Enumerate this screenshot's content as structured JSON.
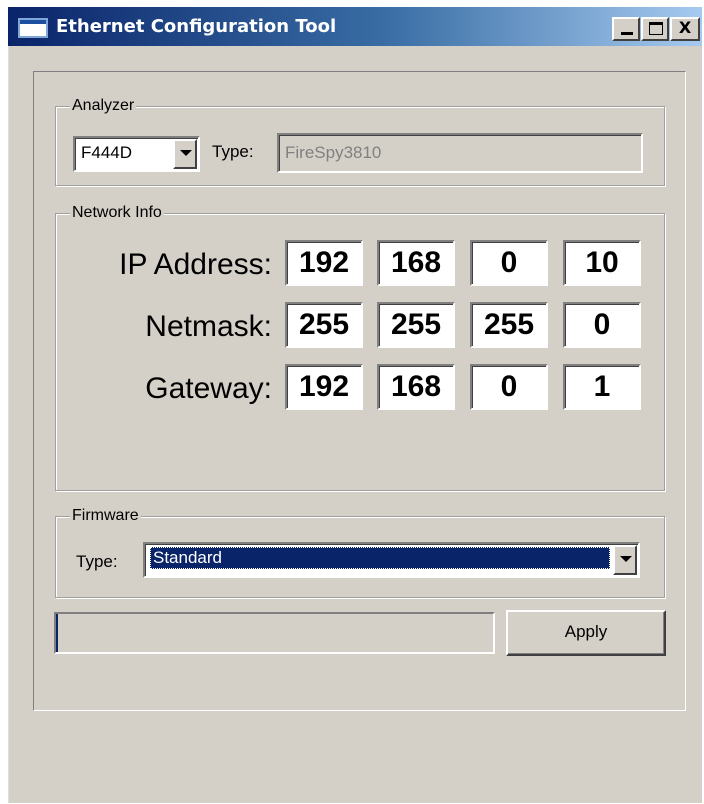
{
  "window": {
    "title": "Ethernet Configuration Tool",
    "min_label": "_",
    "close_label": "X"
  },
  "analyzer": {
    "group_label": "Analyzer",
    "selected": "F444D",
    "type_label": "Type:",
    "type_value": "FireSpy3810"
  },
  "network": {
    "group_label": "Network Info",
    "ip_label": "IP Address:",
    "ip": [
      "192",
      "168",
      "0",
      "10"
    ],
    "netmask_label": "Netmask:",
    "netmask": [
      "255",
      "255",
      "255",
      "0"
    ],
    "gateway_label": "Gateway:",
    "gateway": [
      "192",
      "168",
      "0",
      "1"
    ]
  },
  "firmware": {
    "group_label": "Firmware",
    "type_label": "Type:",
    "selected": "Standard"
  },
  "progress": {
    "fraction": 0.005
  },
  "apply_label": "Apply",
  "colors": {
    "face": "#d4d0c8",
    "title_active": "#0a246a",
    "selection": "#0a246a"
  }
}
